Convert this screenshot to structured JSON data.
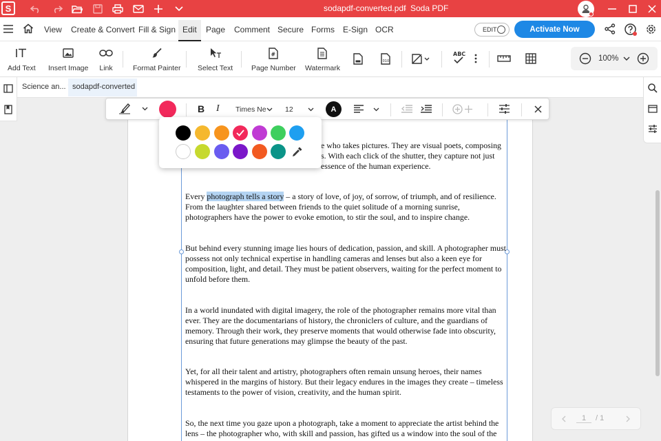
{
  "titlebar": {
    "title": "sodapdf-converted.pdf",
    "separator": "-",
    "app_name": "Soda PDF",
    "logo_letter": "S"
  },
  "menu": {
    "items": [
      "View",
      "Create & Convert",
      "Fill & Sign",
      "Edit",
      "Page",
      "Comment",
      "Secure",
      "Forms",
      "E-Sign",
      "OCR"
    ],
    "active": "Edit",
    "edit_toggle": "EDIT",
    "activate_label": "Activate Now"
  },
  "ribbon": {
    "add_text": "Add Text",
    "insert_image": "Insert Image",
    "link": "Link",
    "format_painter": "Format Painter",
    "select_text": "Select Text",
    "page_number": "Page Number",
    "watermark": "Watermark",
    "spell_icon_text": "ABC",
    "zoom": "100%"
  },
  "tabs": {
    "doc1": "Science an...",
    "doc1_modified": "*",
    "doc2": "sodapdf-converted"
  },
  "text_toolbar": {
    "font": "Times Ne",
    "size": "12",
    "text_color_letter": "A",
    "current_color": "#f2295b"
  },
  "color_picker": {
    "row1": [
      "#000000",
      "#f5b82e",
      "#f7941d",
      "#f2295b",
      "#c03bd4",
      "#3ecf5e",
      "#1e9ff0"
    ],
    "row2": [
      "#ffffff",
      "#c6d92e",
      "#6a5cf0",
      "#7b17c9",
      "#f25a21",
      "#0b9488"
    ],
    "selected": "#f2295b"
  },
  "document": {
    "p1_lines": [
      "e who takes pictures. They are visual poets, composing",
      "s. With each click of the shutter, they capture not just",
      "essence of the human experience."
    ],
    "p2_before": "Every ",
    "p2_highlight": "photograph tells a story",
    "p2_after": " – a story of love, of joy, of sorrow, of triumph, and of resilience. From the laughter shared between friends to the quiet solitude of a morning sunrise, photographers have the power to evoke emotion, to stir the soul, and to inspire change.",
    "p3": "But behind every stunning image lies hours of dedication, passion, and skill. A photographer must possess not only technical expertise in handling cameras and lenses but also a keen eye for composition, light, and detail. They must be patient observers, waiting for the perfect moment to unfold before them.",
    "p4": "In a world inundated with digital imagery, the role of the photographer remains more vital than ever. They are the documentarians of history, the chroniclers of culture, and the guardians of memory. Through their work, they preserve moments that would otherwise fade into obscurity, ensuring that future generations may glimpse the beauty of the past.",
    "p5": "Yet, for all their talent and artistry, photographers often remain unsung heroes, their names whispered in the margins of history. But their legacy endures in the images they create – timeless testaments to the power of vision, creativity, and the human spirit.",
    "p6": "So, the next time you gaze upon a photograph, take a moment to appreciate the artist behind the lens – the photographer who, with skill and passion, has gifted us a window into the soul of the"
  },
  "pagenav": {
    "current": "1",
    "total": "/ 1"
  },
  "colors": {
    "titlebar": "#e84243",
    "accent": "#1e88e5",
    "highlight": "#b3d3f2"
  }
}
